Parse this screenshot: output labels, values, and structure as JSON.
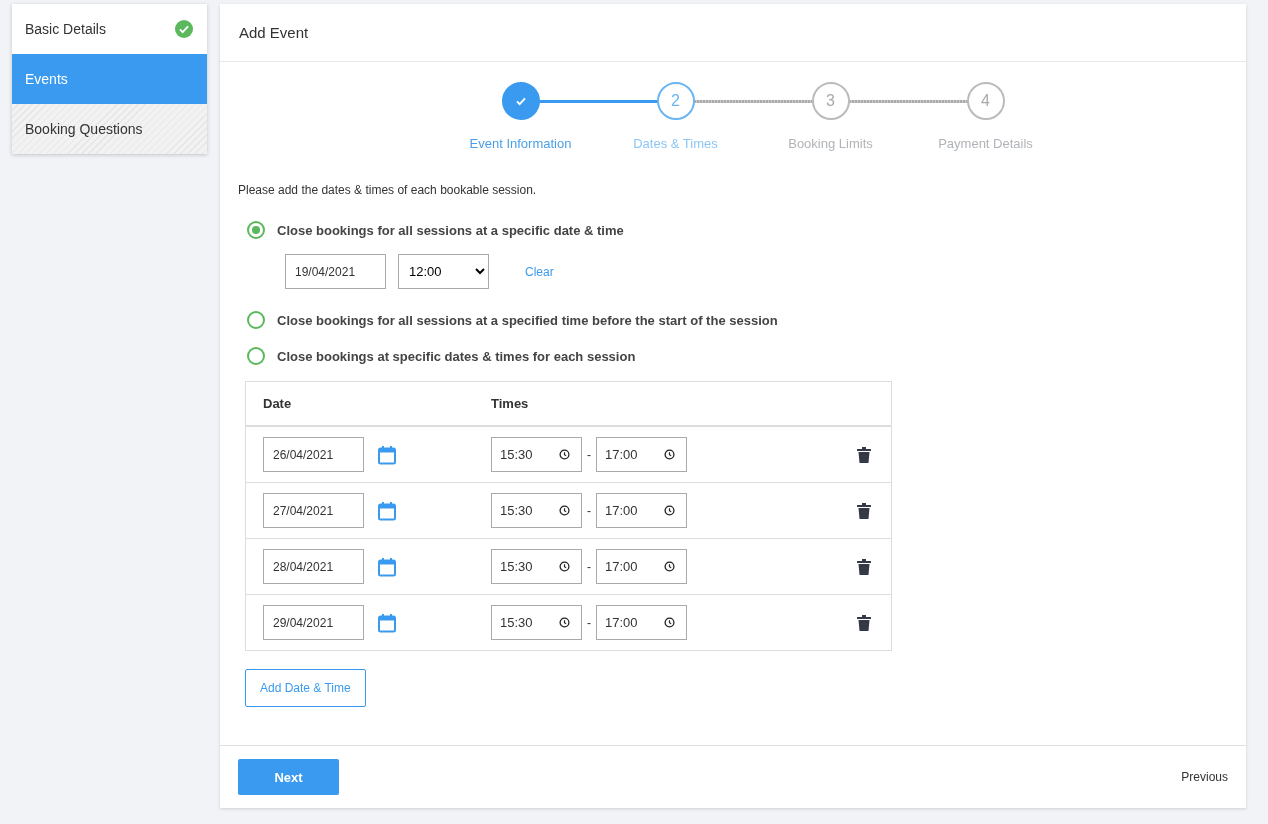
{
  "sidebar": {
    "items": [
      {
        "label": "Basic Details",
        "selected": false,
        "completed": true,
        "disabled": false
      },
      {
        "label": "Events",
        "selected": true,
        "completed": false,
        "disabled": false
      },
      {
        "label": "Booking Questions",
        "selected": false,
        "completed": false,
        "disabled": true
      }
    ]
  },
  "card": {
    "title": "Add Event",
    "steps": [
      {
        "label": "Event Information",
        "done": true,
        "selected": false
      },
      {
        "number": "2",
        "label": "Dates & Times",
        "done": false,
        "selected": true
      },
      {
        "number": "3",
        "label": "Booking Limits",
        "done": false,
        "selected": false
      },
      {
        "number": "4",
        "label": "Payment Details",
        "done": false,
        "selected": false
      }
    ],
    "intro": "Please add the dates & times of each bookable session.",
    "options": [
      {
        "label": "Close bookings for all sessions at a specific date & time",
        "selected": true
      },
      {
        "label": "Close bookings for all sessions at a specified time before the start of the session",
        "selected": false
      },
      {
        "label": "Close bookings at specific dates & times for each session",
        "selected": false
      }
    ],
    "close_date": "19/04/2021",
    "close_time": "12:00",
    "clear_link": "Clear",
    "table": {
      "columns": [
        "Date",
        "Times"
      ],
      "rows": [
        {
          "date": "26/04/2021",
          "start": "15:30",
          "separator": "-",
          "end": "17:00"
        },
        {
          "date": "27/04/2021",
          "start": "15:30",
          "separator": "-",
          "end": "17:00"
        },
        {
          "date": "28/04/2021",
          "start": "15:30",
          "separator": "-",
          "end": "17:00"
        },
        {
          "date": "29/04/2021",
          "start": "15:30",
          "separator": "-",
          "end": "17:00"
        }
      ]
    },
    "add_button": "Add Date & Time",
    "next_button": "Next",
    "previous_link": "Previous"
  }
}
